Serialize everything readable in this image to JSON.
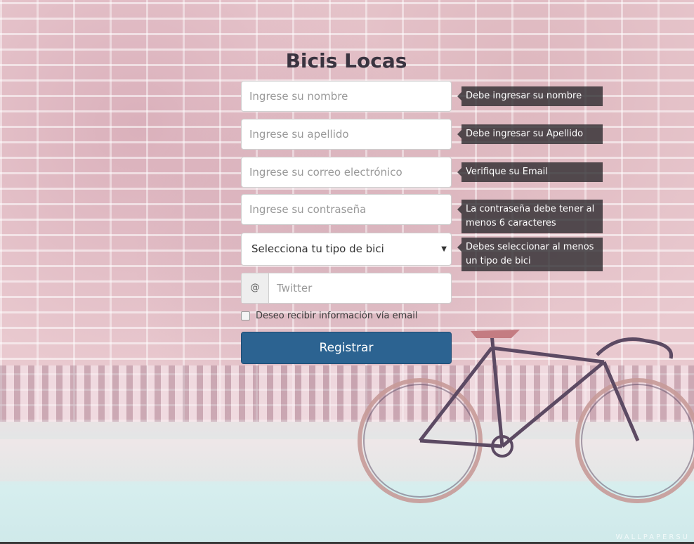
{
  "app": {
    "title": "Bicis Locas",
    "watermark": "WALLPAPERSU"
  },
  "form": {
    "nombre": {
      "placeholder": "Ingrese su nombre",
      "error": "Debe ingresar su nombre"
    },
    "apellido": {
      "placeholder": "Ingrese su apellido",
      "error": "Debe ingresar su Apellido"
    },
    "email": {
      "placeholder": "Ingrese su correo electrónico",
      "error": "Verifique su Email"
    },
    "password": {
      "placeholder": "Ingrese su contraseña",
      "error": "La contraseña debe tener al menos 6 caracteres"
    },
    "bike_type": {
      "selected": "Selecciona tu tipo de bici",
      "error": "Debes seleccionar al menos un tipo de bici"
    },
    "twitter": {
      "addon": "@",
      "placeholder": "Twitter"
    },
    "newsletter": {
      "label": "Deseo recibir información vía email",
      "checked": false
    },
    "submit_label": "Registrar"
  },
  "colors": {
    "primary_button": "#2c6391",
    "tooltip_bg": "#28262a",
    "title": "#3a3440"
  }
}
